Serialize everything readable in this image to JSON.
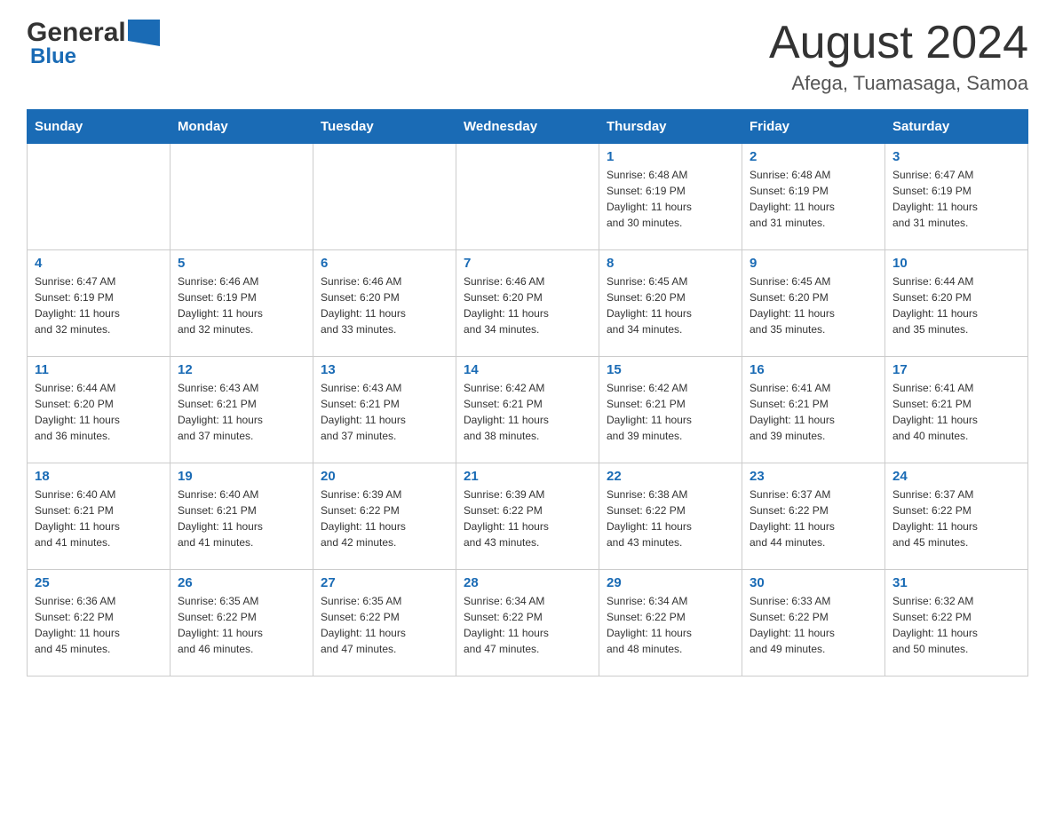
{
  "logo": {
    "general_text": "General",
    "blue_text": "Blue"
  },
  "title": "August 2024",
  "subtitle": "Afega, Tuamasaga, Samoa",
  "days_of_week": [
    "Sunday",
    "Monday",
    "Tuesday",
    "Wednesday",
    "Thursday",
    "Friday",
    "Saturday"
  ],
  "weeks": [
    [
      {
        "day": "",
        "info": ""
      },
      {
        "day": "",
        "info": ""
      },
      {
        "day": "",
        "info": ""
      },
      {
        "day": "",
        "info": ""
      },
      {
        "day": "1",
        "info": "Sunrise: 6:48 AM\nSunset: 6:19 PM\nDaylight: 11 hours\nand 30 minutes."
      },
      {
        "day": "2",
        "info": "Sunrise: 6:48 AM\nSunset: 6:19 PM\nDaylight: 11 hours\nand 31 minutes."
      },
      {
        "day": "3",
        "info": "Sunrise: 6:47 AM\nSunset: 6:19 PM\nDaylight: 11 hours\nand 31 minutes."
      }
    ],
    [
      {
        "day": "4",
        "info": "Sunrise: 6:47 AM\nSunset: 6:19 PM\nDaylight: 11 hours\nand 32 minutes."
      },
      {
        "day": "5",
        "info": "Sunrise: 6:46 AM\nSunset: 6:19 PM\nDaylight: 11 hours\nand 32 minutes."
      },
      {
        "day": "6",
        "info": "Sunrise: 6:46 AM\nSunset: 6:20 PM\nDaylight: 11 hours\nand 33 minutes."
      },
      {
        "day": "7",
        "info": "Sunrise: 6:46 AM\nSunset: 6:20 PM\nDaylight: 11 hours\nand 34 minutes."
      },
      {
        "day": "8",
        "info": "Sunrise: 6:45 AM\nSunset: 6:20 PM\nDaylight: 11 hours\nand 34 minutes."
      },
      {
        "day": "9",
        "info": "Sunrise: 6:45 AM\nSunset: 6:20 PM\nDaylight: 11 hours\nand 35 minutes."
      },
      {
        "day": "10",
        "info": "Sunrise: 6:44 AM\nSunset: 6:20 PM\nDaylight: 11 hours\nand 35 minutes."
      }
    ],
    [
      {
        "day": "11",
        "info": "Sunrise: 6:44 AM\nSunset: 6:20 PM\nDaylight: 11 hours\nand 36 minutes."
      },
      {
        "day": "12",
        "info": "Sunrise: 6:43 AM\nSunset: 6:21 PM\nDaylight: 11 hours\nand 37 minutes."
      },
      {
        "day": "13",
        "info": "Sunrise: 6:43 AM\nSunset: 6:21 PM\nDaylight: 11 hours\nand 37 minutes."
      },
      {
        "day": "14",
        "info": "Sunrise: 6:42 AM\nSunset: 6:21 PM\nDaylight: 11 hours\nand 38 minutes."
      },
      {
        "day": "15",
        "info": "Sunrise: 6:42 AM\nSunset: 6:21 PM\nDaylight: 11 hours\nand 39 minutes."
      },
      {
        "day": "16",
        "info": "Sunrise: 6:41 AM\nSunset: 6:21 PM\nDaylight: 11 hours\nand 39 minutes."
      },
      {
        "day": "17",
        "info": "Sunrise: 6:41 AM\nSunset: 6:21 PM\nDaylight: 11 hours\nand 40 minutes."
      }
    ],
    [
      {
        "day": "18",
        "info": "Sunrise: 6:40 AM\nSunset: 6:21 PM\nDaylight: 11 hours\nand 41 minutes."
      },
      {
        "day": "19",
        "info": "Sunrise: 6:40 AM\nSunset: 6:21 PM\nDaylight: 11 hours\nand 41 minutes."
      },
      {
        "day": "20",
        "info": "Sunrise: 6:39 AM\nSunset: 6:22 PM\nDaylight: 11 hours\nand 42 minutes."
      },
      {
        "day": "21",
        "info": "Sunrise: 6:39 AM\nSunset: 6:22 PM\nDaylight: 11 hours\nand 43 minutes."
      },
      {
        "day": "22",
        "info": "Sunrise: 6:38 AM\nSunset: 6:22 PM\nDaylight: 11 hours\nand 43 minutes."
      },
      {
        "day": "23",
        "info": "Sunrise: 6:37 AM\nSunset: 6:22 PM\nDaylight: 11 hours\nand 44 minutes."
      },
      {
        "day": "24",
        "info": "Sunrise: 6:37 AM\nSunset: 6:22 PM\nDaylight: 11 hours\nand 45 minutes."
      }
    ],
    [
      {
        "day": "25",
        "info": "Sunrise: 6:36 AM\nSunset: 6:22 PM\nDaylight: 11 hours\nand 45 minutes."
      },
      {
        "day": "26",
        "info": "Sunrise: 6:35 AM\nSunset: 6:22 PM\nDaylight: 11 hours\nand 46 minutes."
      },
      {
        "day": "27",
        "info": "Sunrise: 6:35 AM\nSunset: 6:22 PM\nDaylight: 11 hours\nand 47 minutes."
      },
      {
        "day": "28",
        "info": "Sunrise: 6:34 AM\nSunset: 6:22 PM\nDaylight: 11 hours\nand 47 minutes."
      },
      {
        "day": "29",
        "info": "Sunrise: 6:34 AM\nSunset: 6:22 PM\nDaylight: 11 hours\nand 48 minutes."
      },
      {
        "day": "30",
        "info": "Sunrise: 6:33 AM\nSunset: 6:22 PM\nDaylight: 11 hours\nand 49 minutes."
      },
      {
        "day": "31",
        "info": "Sunrise: 6:32 AM\nSunset: 6:22 PM\nDaylight: 11 hours\nand 50 minutes."
      }
    ]
  ]
}
